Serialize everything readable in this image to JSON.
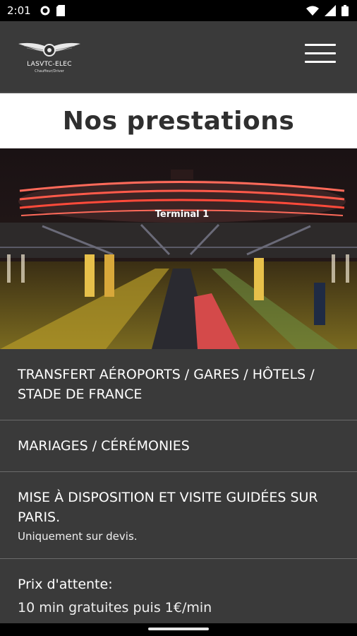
{
  "status_bar": {
    "time": "2:01",
    "icons_left": [
      "gear-icon",
      "sim-card-icon"
    ],
    "icons_right": [
      "wifi-icon",
      "signal-icon",
      "battery-icon"
    ]
  },
  "header": {
    "logo_title": "LASVTC-ELEC",
    "logo_subtitle": "Chauffeur/Driver",
    "menu_icon": "hamburger-menu-icon"
  },
  "page": {
    "title": "Nos prestations"
  },
  "hero": {
    "sign_text": "Terminal 1"
  },
  "services": [
    {
      "title": "TRANSFERT AÉROPORTS / GARES / HÔTELS / STADE DE FRANCE",
      "note": ""
    },
    {
      "title": "MARIAGES / CÉRÉMONIES",
      "note": ""
    },
    {
      "title": "MISE À DISPOSITION ET VISITE GUIDÉES SUR PARIS.",
      "note": "Uniquement sur devis."
    },
    {
      "title": "Prix d'attente:",
      "note": "10 min gratuites puis 1€/min"
    }
  ],
  "colors": {
    "background": "#3a3a3a",
    "title_band": "#ffffff",
    "text": "#ffffff"
  }
}
